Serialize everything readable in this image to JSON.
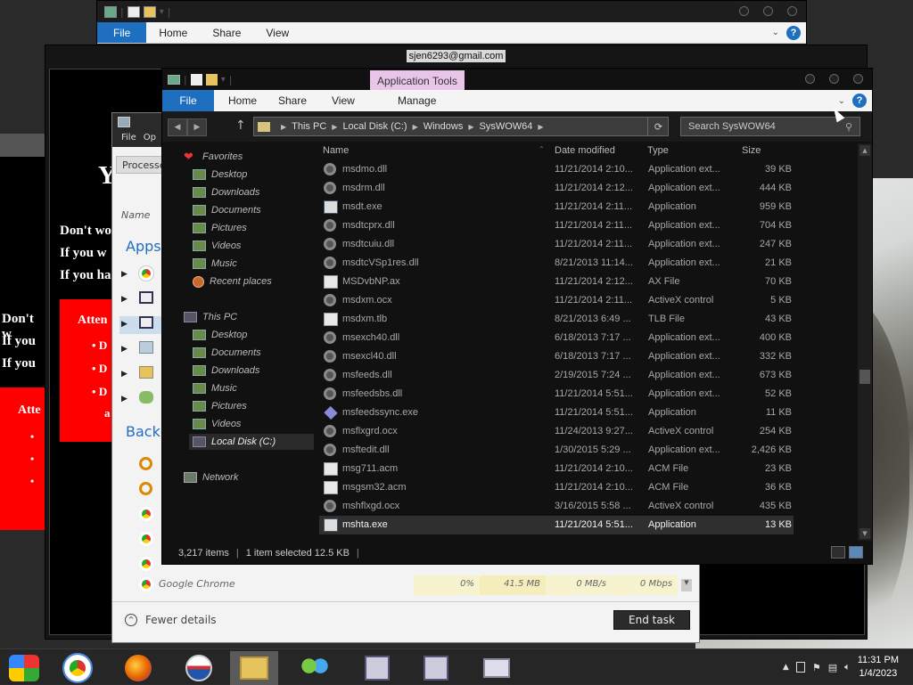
{
  "email_title": "sjen6293@gmail.com",
  "top_window": {
    "tabs": [
      "File",
      "Home",
      "Share",
      "View"
    ]
  },
  "ransom": {
    "heading_partial": "Y",
    "lines1": [
      "Don't wo",
      "If you w",
      "If you ha"
    ],
    "lines2": [
      "Don't w",
      "If you",
      "If you"
    ],
    "attention_label": "Atten",
    "attention_label2": "Atte",
    "bullets": [
      "D",
      "D",
      "D",
      "a"
    ]
  },
  "task_manager": {
    "menu": [
      "File",
      "Op"
    ],
    "tab": "Processe",
    "col_name": "Name",
    "apps_group": "Apps",
    "background_group": "Backg",
    "row_chrome": {
      "name": "Google Chrome",
      "cpu": "0%",
      "mem": "41.5 MB",
      "disk": "0 MB/s",
      "net": "0 Mbps"
    },
    "fewer_details": "Fewer details",
    "end_task": "End task"
  },
  "explorer": {
    "contextual_tab": "Application Tools",
    "tabs": [
      "File",
      "Home",
      "Share",
      "View",
      "Manage"
    ],
    "breadcrumb": [
      "This PC",
      "Local Disk (C:)",
      "Windows",
      "SysWOW64"
    ],
    "search_placeholder": "Search SysWOW64",
    "nav": {
      "favorites": "Favorites",
      "fav_items": [
        "Desktop",
        "Downloads",
        "Documents",
        "Pictures",
        "Videos",
        "Music",
        "Recent places"
      ],
      "this_pc": "This PC",
      "pc_items": [
        "Desktop",
        "Documents",
        "Downloads",
        "Music",
        "Pictures",
        "Videos",
        "Local Disk (C:)"
      ],
      "network": "Network"
    },
    "columns": [
      "Name",
      "Date modified",
      "Type",
      "Size"
    ],
    "files": [
      {
        "name": "msdmo.dll",
        "date": "11/21/2014 2:10...",
        "type": "Application ext...",
        "size": "39 KB",
        "icon": "gear"
      },
      {
        "name": "msdrm.dll",
        "date": "11/21/2014 2:12...",
        "type": "Application ext...",
        "size": "444 KB",
        "icon": "gear"
      },
      {
        "name": "msdt.exe",
        "date": "11/21/2014 2:11...",
        "type": "Application",
        "size": "959 KB",
        "icon": "app"
      },
      {
        "name": "msdtcprx.dll",
        "date": "11/21/2014 2:11...",
        "type": "Application ext...",
        "size": "704 KB",
        "icon": "gear"
      },
      {
        "name": "msdtcuiu.dll",
        "date": "11/21/2014 2:11...",
        "type": "Application ext...",
        "size": "247 KB",
        "icon": "gear"
      },
      {
        "name": "msdtcVSp1res.dll",
        "date": "8/21/2013 11:14...",
        "type": "Application ext...",
        "size": "21 KB",
        "icon": "gear"
      },
      {
        "name": "MSDvbNP.ax",
        "date": "11/21/2014 2:12...",
        "type": "AX File",
        "size": "70 KB",
        "icon": "doc"
      },
      {
        "name": "msdxm.ocx",
        "date": "11/21/2014 2:11...",
        "type": "ActiveX control",
        "size": "5 KB",
        "icon": "gear"
      },
      {
        "name": "msdxm.tlb",
        "date": "8/21/2013 6:49 ...",
        "type": "TLB File",
        "size": "43 KB",
        "icon": "doc"
      },
      {
        "name": "msexch40.dll",
        "date": "6/18/2013 7:17 ...",
        "type": "Application ext...",
        "size": "400 KB",
        "icon": "gear"
      },
      {
        "name": "msexcl40.dll",
        "date": "6/18/2013 7:17 ...",
        "type": "Application ext...",
        "size": "332 KB",
        "icon": "gear"
      },
      {
        "name": "msfeeds.dll",
        "date": "2/19/2015 7:24 ...",
        "type": "Application ext...",
        "size": "673 KB",
        "icon": "gear"
      },
      {
        "name": "msfeedsbs.dll",
        "date": "11/21/2014 5:51...",
        "type": "Application ext...",
        "size": "52 KB",
        "icon": "gear"
      },
      {
        "name": "msfeedssync.exe",
        "date": "11/21/2014 5:51...",
        "type": "Application",
        "size": "11 KB",
        "icon": "diamond"
      },
      {
        "name": "msflxgrd.ocx",
        "date": "11/24/2013 9:27...",
        "type": "ActiveX control",
        "size": "254 KB",
        "icon": "gear"
      },
      {
        "name": "msftedit.dll",
        "date": "1/30/2015 5:29 ...",
        "type": "Application ext...",
        "size": "2,426 KB",
        "icon": "gear"
      },
      {
        "name": "msg711.acm",
        "date": "11/21/2014 2:10...",
        "type": "ACM File",
        "size": "23 KB",
        "icon": "doc"
      },
      {
        "name": "msgsm32.acm",
        "date": "11/21/2014 2:10...",
        "type": "ACM File",
        "size": "36 KB",
        "icon": "doc"
      },
      {
        "name": "mshflxgd.ocx",
        "date": "3/16/2015 5:58 ...",
        "type": "ActiveX control",
        "size": "435 KB",
        "icon": "gear"
      },
      {
        "name": "mshta.exe",
        "date": "11/21/2014 5:51...",
        "type": "Application",
        "size": "13 KB",
        "icon": "app",
        "selected": true
      }
    ],
    "status": {
      "count": "3,217 items",
      "selected": "1 item selected  12.5 KB"
    }
  },
  "taskbar": {
    "time": "11:31 PM",
    "date": "1/4/2023"
  },
  "colors": {
    "accent": "#1e6fc0",
    "app_tools": "#e9c6e9",
    "attention_red": "#ff0000"
  }
}
